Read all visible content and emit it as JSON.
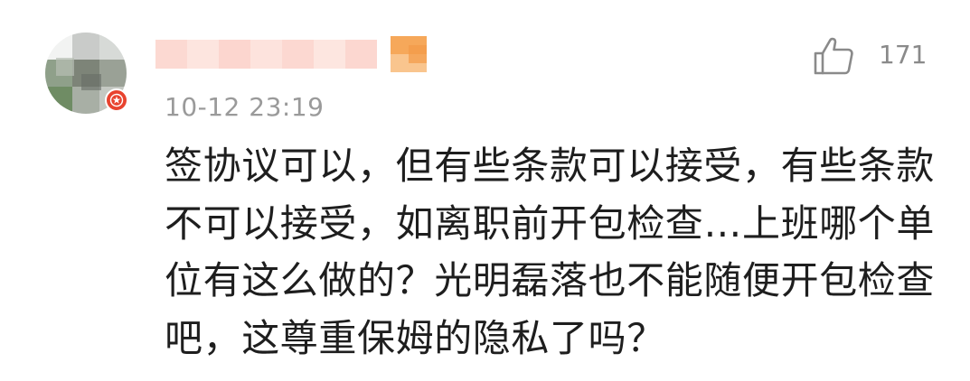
{
  "comment": {
    "username_blurred": true,
    "timestamp": "10-12 23:19",
    "like": {
      "icon": "thumbs-up-icon",
      "count": "171"
    },
    "badge_icon": "verified-star-icon",
    "text": "签协议可以，但有些条款可以接受，有些条款\n不可以接受，如离职前开包检查…上班哪个单\n位有这么做的？光明磊落也不能随便开包检查\n吧，这尊重保姆的隐私了吗？"
  },
  "colors": {
    "badge": "#e8432f",
    "timestamp": "#9a9a9a",
    "text": "#1e1e1e",
    "like": "#8a8a8a"
  }
}
